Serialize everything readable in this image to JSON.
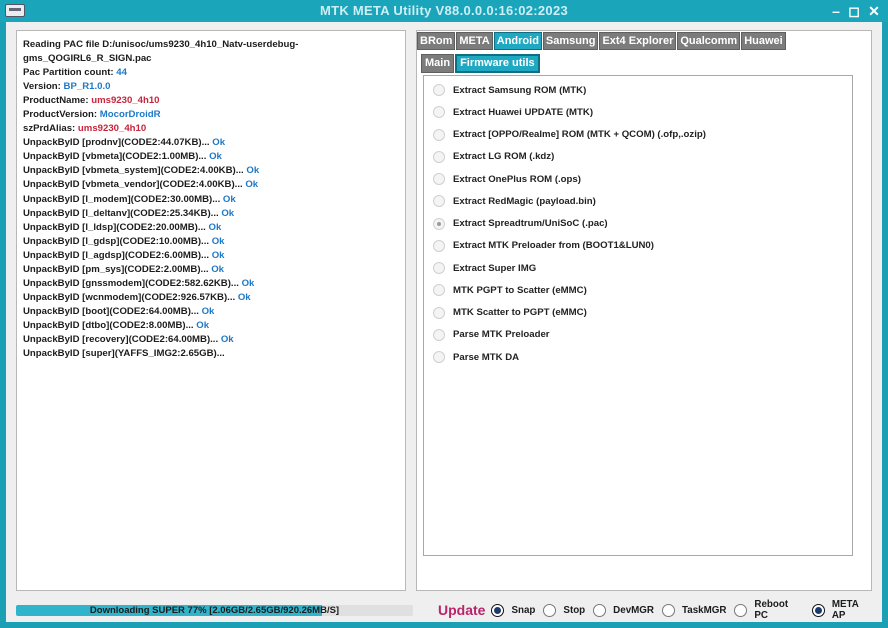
{
  "window": {
    "title": "MTK META Utility V88.0.0.0:16:02:2023",
    "min_glyph": "–",
    "max_glyph": "◻",
    "close_glyph": "✕"
  },
  "log": [
    {
      "text": "Reading PAC file D:/unisoc/ums9230_4h10_Natv-userdebug-",
      "value": "",
      "color": ""
    },
    {
      "text": "gms_QOGIRL6_R_SIGN.pac",
      "value": "",
      "color": ""
    },
    {
      "text": "Pac Partition count: ",
      "value": "44",
      "color": "blue"
    },
    {
      "text": "Version: ",
      "value": "BP_R1.0.0",
      "color": "blue"
    },
    {
      "text": "ProductName: ",
      "value": "ums9230_4h10",
      "color": "red"
    },
    {
      "text": "ProductVersion: ",
      "value": "MocorDroidR",
      "color": "blue"
    },
    {
      "text": "szPrdAlias: ",
      "value": "ums9230_4h10",
      "color": "red"
    },
    {
      "text": "UnpackByID [prodnv](CODE2:44.07KB)... ",
      "value": "Ok",
      "color": "blue"
    },
    {
      "text": "UnpackByID [vbmeta](CODE2:1.00MB)... ",
      "value": "Ok",
      "color": "blue"
    },
    {
      "text": "UnpackByID [vbmeta_system](CODE2:4.00KB)... ",
      "value": "Ok",
      "color": "blue"
    },
    {
      "text": "UnpackByID [vbmeta_vendor](CODE2:4.00KB)... ",
      "value": "Ok",
      "color": "blue"
    },
    {
      "text": "UnpackByID [l_modem](CODE2:30.00MB)... ",
      "value": "Ok",
      "color": "blue"
    },
    {
      "text": "UnpackByID [l_deltanv](CODE2:25.34KB)... ",
      "value": "Ok",
      "color": "blue"
    },
    {
      "text": "UnpackByID [l_ldsp](CODE2:20.00MB)... ",
      "value": "Ok",
      "color": "blue"
    },
    {
      "text": "UnpackByID [l_gdsp](CODE2:10.00MB)... ",
      "value": "Ok",
      "color": "blue"
    },
    {
      "text": "UnpackByID [l_agdsp](CODE2:6.00MB)... ",
      "value": "Ok",
      "color": "blue"
    },
    {
      "text": "UnpackByID [pm_sys](CODE2:2.00MB)... ",
      "value": "Ok",
      "color": "blue"
    },
    {
      "text": "UnpackByID [gnssmodem](CODE2:582.62KB)... ",
      "value": "Ok",
      "color": "blue"
    },
    {
      "text": "UnpackByID [wcnmodem](CODE2:926.57KB)... ",
      "value": "Ok",
      "color": "blue"
    },
    {
      "text": "UnpackByID [boot](CODE2:64.00MB)... ",
      "value": "Ok",
      "color": "blue"
    },
    {
      "text": "UnpackByID [dtbo](CODE2:8.00MB)... ",
      "value": "Ok",
      "color": "blue"
    },
    {
      "text": "UnpackByID [recovery](CODE2:64.00MB)... ",
      "value": "Ok",
      "color": "blue"
    },
    {
      "text": "UnpackByID [super](YAFFS_IMG2:2.65GB)...",
      "value": "",
      "color": ""
    }
  ],
  "top_tabs": [
    {
      "label": "BRom",
      "active": false
    },
    {
      "label": "META",
      "active": false
    },
    {
      "label": "Android",
      "active": true
    },
    {
      "label": "Samsung",
      "active": false
    },
    {
      "label": "Ext4 Explorer",
      "active": false
    },
    {
      "label": "Qualcomm",
      "active": false
    },
    {
      "label": "Huawei",
      "active": false
    }
  ],
  "sub_tabs": [
    {
      "label": "Main",
      "active": false
    },
    {
      "label": "Firmware utils",
      "active": true
    }
  ],
  "options": [
    {
      "label": "Extract Samsung ROM (MTK)",
      "selected": false
    },
    {
      "label": "Extract Huawei UPDATE (MTK)",
      "selected": false
    },
    {
      "label": "Extract [OPPO/Realme] ROM (MTK + QCOM) (.ofp,.ozip)",
      "selected": false
    },
    {
      "label": "Extract LG ROM (.kdz)",
      "selected": false
    },
    {
      "label": "Extract OnePlus ROM (.ops)",
      "selected": false
    },
    {
      "label": "Extract RedMagic (payload.bin)",
      "selected": false
    },
    {
      "label": "Extract Spreadtrum/UniSoC (.pac)",
      "selected": true
    },
    {
      "label": "Extract MTK Preloader from (BOOT1&LUN0)",
      "selected": false
    },
    {
      "label": "Extract Super IMG",
      "selected": false
    },
    {
      "label": "MTK PGPT to Scatter (eMMC)",
      "selected": false
    },
    {
      "label": "MTK Scatter to PGPT (eMMC)",
      "selected": false
    },
    {
      "label": "Parse MTK Preloader",
      "selected": false
    },
    {
      "label": "Parse MTK DA",
      "selected": false
    }
  ],
  "progress": {
    "text": "Downloading SUPER 77% [2.06GB/2.65GB/920.26MB/S]",
    "percent": 77
  },
  "bottom": {
    "update_label": "Update",
    "radios": [
      {
        "label": "Snap",
        "selected": true
      },
      {
        "label": "Stop",
        "selected": false
      },
      {
        "label": "DevMGR",
        "selected": false
      },
      {
        "label": "TaskMGR",
        "selected": false
      },
      {
        "label": "Reboot PC",
        "selected": false
      },
      {
        "label": "META AP",
        "selected": true
      }
    ]
  }
}
